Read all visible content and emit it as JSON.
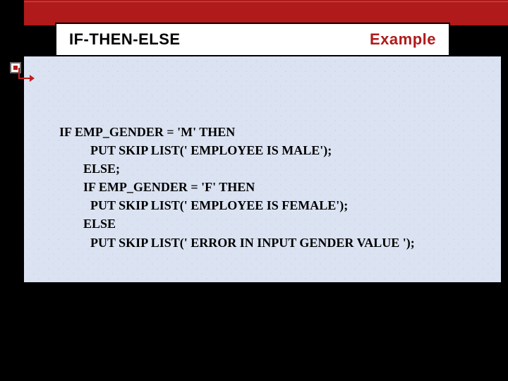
{
  "title": {
    "left": "IF-THEN-ELSE",
    "right": "Example"
  },
  "code": {
    "l0": "IF EMP_GENDER = 'M' THEN",
    "l1": "PUT SKIP LIST(' EMPLOYEE IS MALE');",
    "l2": "ELSE;",
    "l3": "IF EMP_GENDER = 'F' THEN",
    "l4": "PUT SKIP LIST(' EMPLOYEE IS FEMALE');",
    "l5": "ELSE",
    "l6": "PUT SKIP LIST(' ERROR IN INPUT GENDER VALUE ');"
  }
}
